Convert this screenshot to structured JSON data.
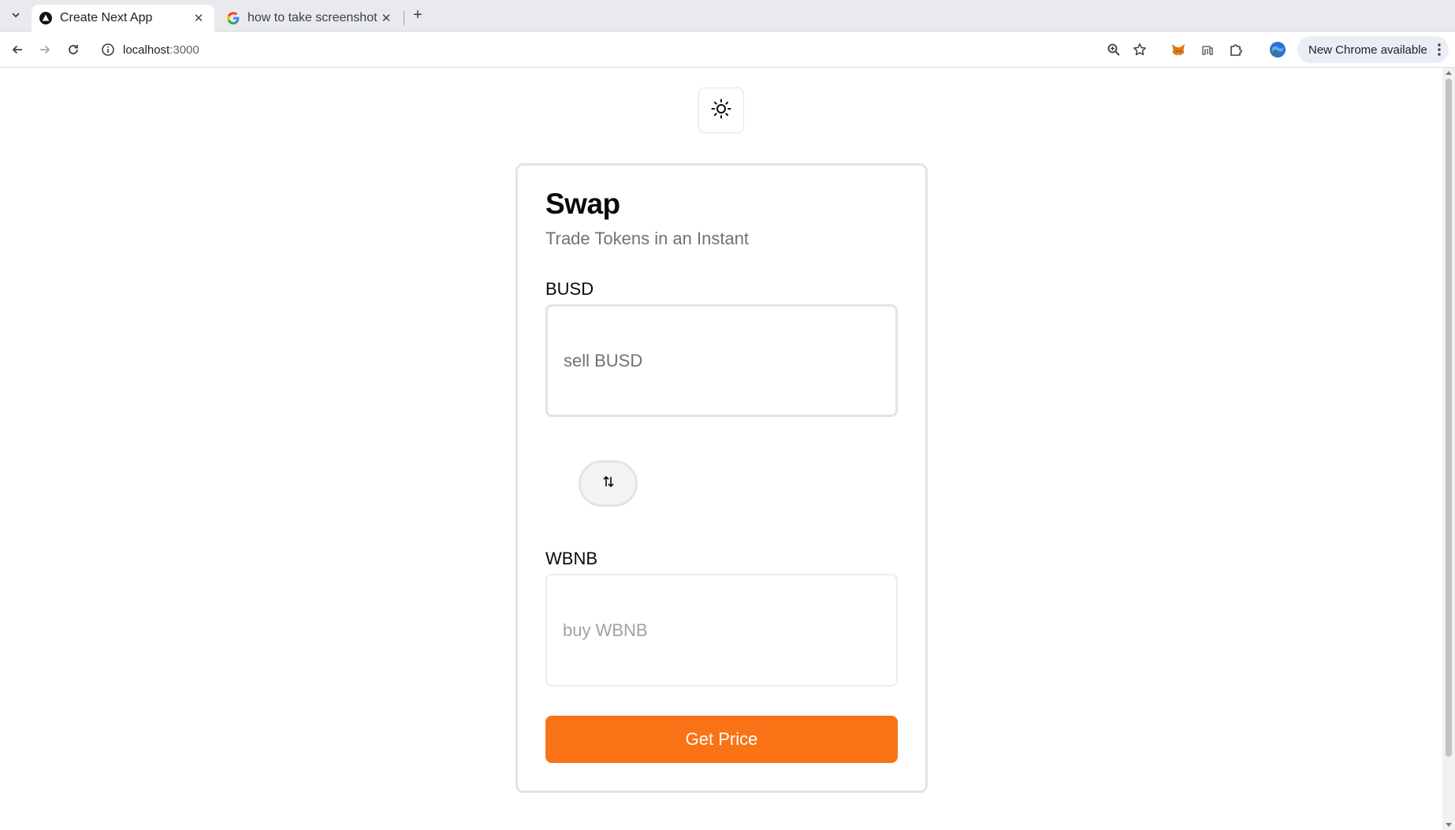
{
  "browser": {
    "tabs": [
      {
        "title": "Create Next App",
        "active": true
      },
      {
        "title": "how to take screenshot i",
        "active": false
      }
    ],
    "url_host": "localhost",
    "url_port": ":3000",
    "update_label": "New Chrome available"
  },
  "page": {
    "title": "Swap",
    "subtitle": "Trade Tokens in an Instant",
    "sell": {
      "token": "BUSD",
      "placeholder": "sell BUSD"
    },
    "buy": {
      "token": "WBNB",
      "placeholder": "buy WBNB"
    },
    "action_label": "Get Price"
  },
  "colors": {
    "accent": "#f97316",
    "border": "#e4e4e7",
    "muted_text": "#71717a"
  }
}
